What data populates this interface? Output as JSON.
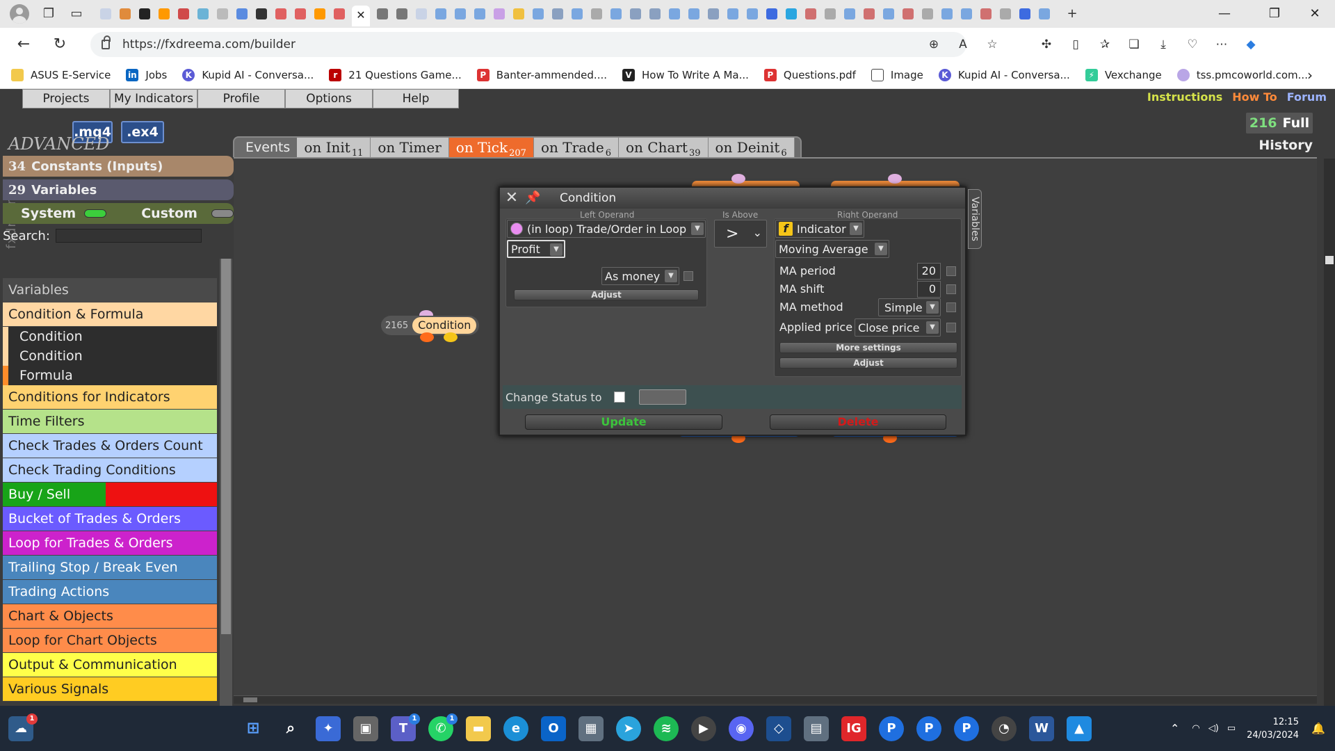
{
  "browser": {
    "url": "https://fxdreema.com/builder",
    "bookmarks": [
      "ASUS E-Service",
      "Jobs",
      "Kupid AI - Conversa...",
      "21 Questions Game...",
      "Banter-ammended....",
      "How To Write A Ma...",
      "Questions.pdf",
      "Image",
      "Kupid AI - Conversa...",
      "Vexchange",
      "tss.pmcoworld.com..."
    ]
  },
  "app": {
    "brand": "fxdreema",
    "menu": [
      "Projects",
      "My Indicators",
      "Profile",
      "Options",
      "Help"
    ],
    "right_links": {
      "instructions": "Instructions",
      "howto": "How To",
      "forum": "Forum"
    },
    "colors": {
      "instructions": "#d6e34a",
      "howto": "#ff8a3a",
      "forum": "#9db4ff"
    },
    "badges": {
      "mq4": ".mq4",
      "ex4": ".ex4"
    },
    "history": {
      "count": "216",
      "full": "Full",
      "label": "History"
    },
    "events": {
      "label": "Events",
      "tabs": [
        {
          "name": "on Init",
          "count": "11"
        },
        {
          "name": "on Timer",
          "count": ""
        },
        {
          "name": "on Tick",
          "count": "207"
        },
        {
          "name": "on Trade",
          "count": "6"
        },
        {
          "name": "on Chart",
          "count": "39"
        },
        {
          "name": "on Deinit",
          "count": "6"
        }
      ]
    }
  },
  "sidebar": {
    "advanced": "ADVANCED",
    "constants": {
      "count": "34",
      "label": "Constants (Inputs)"
    },
    "variables": {
      "count": "29",
      "label": "Variables"
    },
    "system": "System",
    "custom": "Custom",
    "search_label": "Search:",
    "categories": [
      {
        "label": "Variables",
        "bg": "#4a4a4a",
        "fg": "#cfcfcf"
      },
      {
        "label": "Condition & Formula",
        "bg": "#ffd7a3",
        "fg": "#222"
      },
      {
        "label": "Conditions for Indicators",
        "bg": "#ffd270",
        "fg": "#222"
      },
      {
        "label": "Time Filters",
        "bg": "#b5e28a",
        "fg": "#222"
      },
      {
        "label": "Check Trades & Orders Count",
        "bg": "#b5d0ff",
        "fg": "#222"
      },
      {
        "label": "Check Trading Conditions",
        "bg": "#b5d0ff",
        "fg": "#222"
      },
      {
        "label": "Buy / Sell",
        "bg": "#18a418",
        "fg": "#fff"
      },
      {
        "label": "Bucket of Trades & Orders",
        "bg": "#6b5bff",
        "fg": "#fff"
      },
      {
        "label": "Loop for Trades & Orders",
        "bg": "#cc22cc",
        "fg": "#fff"
      },
      {
        "label": "Trailing Stop / Break Even",
        "bg": "#4a86bd",
        "fg": "#fff"
      },
      {
        "label": "Trading Actions",
        "bg": "#4a86bd",
        "fg": "#fff"
      },
      {
        "label": "Chart & Objects",
        "bg": "#ff8c4a",
        "fg": "#222"
      },
      {
        "label": "Loop for Chart Objects",
        "bg": "#ff8c4a",
        "fg": "#222"
      },
      {
        "label": "Output & Communication",
        "bg": "#ffff4a",
        "fg": "#222"
      },
      {
        "label": "Various Signals",
        "bg": "#ffcc22",
        "fg": "#222"
      }
    ],
    "subitems": [
      "Condition",
      "Condition",
      "Formula"
    ]
  },
  "canvas": {
    "node": {
      "id": "2165",
      "label": "Condition"
    }
  },
  "dialog": {
    "title": "Condition",
    "side_tab": "Variables",
    "left": {
      "header": "Left Operand",
      "source": "(in loop) Trade/Order in Loop",
      "field": "Profit",
      "mode": "As money",
      "adjust": "Adjust"
    },
    "operator": {
      "header": "Is Above",
      "symbol": ">"
    },
    "right": {
      "header": "Right Operand",
      "source": "Indicator",
      "indicator": "Moving Average",
      "params": [
        {
          "label": "MA period",
          "value": "20"
        },
        {
          "label": "MA shift",
          "value": "0"
        },
        {
          "label": "MA method",
          "value": "Simple"
        },
        {
          "label": "Applied price",
          "value": "Close price"
        }
      ],
      "more": "More settings",
      "adjust": "Adjust"
    },
    "status_label": "Change Status to",
    "update": "Update",
    "delete": "Delete"
  },
  "taskbar": {
    "clock_time": "12:15",
    "clock_date": "24/03/2024"
  }
}
